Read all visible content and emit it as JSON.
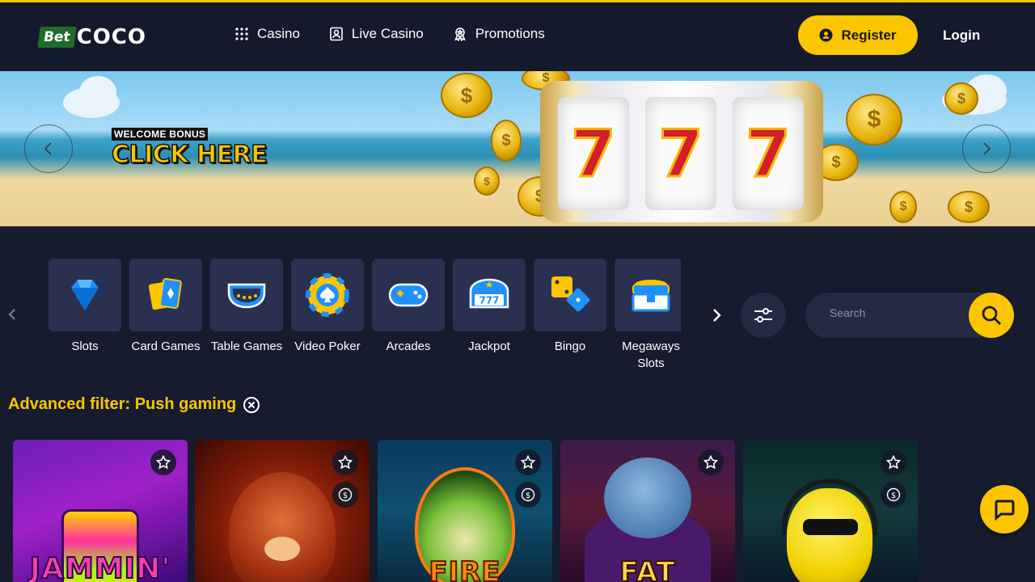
{
  "header": {
    "logo": {
      "bet": "Bet",
      "coco": "COCO"
    },
    "nav": [
      {
        "label": "Casino",
        "icon": "grid-icon"
      },
      {
        "label": "Live Casino",
        "icon": "user-card-icon"
      },
      {
        "label": "Promotions",
        "icon": "award-icon"
      }
    ],
    "register_label": "Register",
    "login_label": "Login"
  },
  "banner": {
    "eyebrow": "WELCOME BONUS",
    "cta": "CLICK HERE",
    "reel_symbol": "7"
  },
  "categories": [
    {
      "label": "Slots",
      "icon": "diamond-icon"
    },
    {
      "label": "Card Games",
      "icon": "cards-icon"
    },
    {
      "label": "Table Games",
      "icon": "table-icon"
    },
    {
      "label": "Video Poker",
      "icon": "poker-chip-icon"
    },
    {
      "label": "Arcades",
      "icon": "gamepad-icon"
    },
    {
      "label": "Jackpot",
      "icon": "jackpot-icon"
    },
    {
      "label": "Bingo",
      "icon": "dice-icon"
    },
    {
      "label": "Megaways Slots",
      "icon": "treasure-chest-icon"
    }
  ],
  "search": {
    "placeholder": "Search"
  },
  "filter": {
    "label": "Advanced filter: Push gaming"
  },
  "games": [
    {
      "title": "JAMMIN'",
      "jackpot": false
    },
    {
      "title": "",
      "jackpot": true
    },
    {
      "title": "FIRE",
      "jackpot": true
    },
    {
      "title": "FAT",
      "jackpot": false
    },
    {
      "title": "",
      "jackpot": true
    }
  ],
  "colors": {
    "accent": "#fbc600",
    "background": "#161b2e",
    "header": "#141a2c",
    "tile": "#2a3150"
  }
}
